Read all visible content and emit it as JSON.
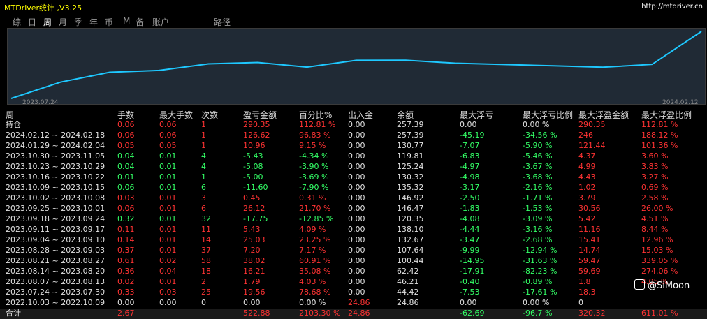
{
  "app": {
    "title": "MTDriver统计 ,V3.25",
    "url": "http://mtdriver.cn"
  },
  "tabs": [
    "综",
    "日",
    "周",
    "月",
    "季",
    "年",
    "币",
    "M",
    "备",
    "账户",
    "路径"
  ],
  "active_tab": 2,
  "chart_data": {
    "type": "line",
    "x_start": "2023.07.24",
    "x_end": "2024.02.12",
    "series": [
      {
        "color": "#1ec8ff",
        "values": [
          0,
          62.42,
          100.44,
          107.64,
          132.67,
          138.1,
          120.35,
          146.47,
          146.92,
          135.32,
          130.32,
          125.24,
          119.81,
          130.77,
          257.39
        ]
      }
    ]
  },
  "table": {
    "headers": [
      "周",
      "手数",
      "最大手数",
      "次数",
      "盈亏金额",
      "百分比%",
      "出入金",
      "余额",
      "最大浮亏",
      "最大浮亏比例",
      "最大浮盈金额",
      "最大浮盈比例"
    ],
    "rows": [
      {
        "c": [
          "持仓",
          "0.06",
          "0.06",
          "1",
          "290.35",
          "112.81 %",
          "0.00",
          "257.39",
          "0.00",
          "0.00 %",
          "290.35",
          "112.81 %"
        ],
        "k": [
          "w",
          "r",
          "r",
          "r",
          "r",
          "r",
          "w",
          "w",
          "w",
          "w",
          "r",
          "r"
        ]
      },
      {
        "c": [
          "2024.02.12 ~ 2024.02.18",
          "0.06",
          "0.06",
          "1",
          "126.62",
          "96.83 %",
          "0.00",
          "257.39",
          "-45.19",
          "-34.56 %",
          "246",
          "188.12 %"
        ],
        "k": [
          "w",
          "r",
          "r",
          "r",
          "r",
          "r",
          "w",
          "w",
          "g",
          "g",
          "r",
          "r"
        ]
      },
      {
        "c": [
          "2024.01.29 ~ 2024.02.04",
          "0.05",
          "0.05",
          "1",
          "10.96",
          "9.15 %",
          "0.00",
          "130.77",
          "-7.07",
          "-5.90 %",
          "121.44",
          "101.36 %"
        ],
        "k": [
          "w",
          "r",
          "r",
          "r",
          "r",
          "r",
          "w",
          "w",
          "g",
          "g",
          "r",
          "r"
        ]
      },
      {
        "c": [
          "2023.10.30 ~ 2023.11.05",
          "0.04",
          "0.01",
          "4",
          "-5.43",
          "-4.34 %",
          "0.00",
          "119.81",
          "-6.83",
          "-5.46 %",
          "4.37",
          "3.60 %"
        ],
        "k": [
          "w",
          "g",
          "g",
          "g",
          "g",
          "g",
          "w",
          "w",
          "g",
          "g",
          "r",
          "r"
        ]
      },
      {
        "c": [
          "2023.10.23 ~ 2023.10.29",
          "0.04",
          "0.01",
          "4",
          "-5.08",
          "-3.90 %",
          "0.00",
          "125.24",
          "-4.97",
          "-3.67 %",
          "4.99",
          "3.83 %"
        ],
        "k": [
          "w",
          "g",
          "g",
          "g",
          "g",
          "g",
          "w",
          "w",
          "g",
          "g",
          "r",
          "r"
        ]
      },
      {
        "c": [
          "2023.10.16 ~ 2023.10.22",
          "0.01",
          "0.01",
          "1",
          "-5.00",
          "-3.69 %",
          "0.00",
          "130.32",
          "-4.98",
          "-3.68 %",
          "4.43",
          "3.27 %"
        ],
        "k": [
          "w",
          "g",
          "g",
          "g",
          "g",
          "g",
          "w",
          "w",
          "g",
          "g",
          "r",
          "r"
        ]
      },
      {
        "c": [
          "2023.10.09 ~ 2023.10.15",
          "0.06",
          "0.01",
          "6",
          "-11.60",
          "-7.90 %",
          "0.00",
          "135.32",
          "-3.17",
          "-2.16 %",
          "1.02",
          "0.69 %"
        ],
        "k": [
          "w",
          "g",
          "g",
          "g",
          "g",
          "g",
          "w",
          "w",
          "g",
          "g",
          "r",
          "r"
        ]
      },
      {
        "c": [
          "2023.10.02 ~ 2023.10.08",
          "0.03",
          "0.01",
          "3",
          "0.45",
          "0.31 %",
          "0.00",
          "146.92",
          "-2.50",
          "-1.71 %",
          "3.79",
          "2.58 %"
        ],
        "k": [
          "w",
          "r",
          "r",
          "r",
          "r",
          "r",
          "w",
          "w",
          "g",
          "g",
          "r",
          "r"
        ]
      },
      {
        "c": [
          "2023.09.25 ~ 2023.10.01",
          "0.06",
          "0.01",
          "6",
          "26.12",
          "21.70 %",
          "0.00",
          "146.47",
          "-1.83",
          "-1.53 %",
          "30.56",
          "26.00 %"
        ],
        "k": [
          "w",
          "r",
          "r",
          "r",
          "r",
          "r",
          "w",
          "w",
          "g",
          "g",
          "r",
          "r"
        ]
      },
      {
        "c": [
          "2023.09.18 ~ 2023.09.24",
          "0.32",
          "0.01",
          "32",
          "-17.75",
          "-12.85 %",
          "0.00",
          "120.35",
          "-4.08",
          "-3.09 %",
          "5.42",
          "4.51 %"
        ],
        "k": [
          "w",
          "g",
          "g",
          "g",
          "g",
          "g",
          "w",
          "w",
          "g",
          "g",
          "r",
          "r"
        ]
      },
      {
        "c": [
          "2023.09.11 ~ 2023.09.17",
          "0.11",
          "0.01",
          "11",
          "5.43",
          "4.09 %",
          "0.00",
          "138.10",
          "-4.44",
          "-3.16 %",
          "11.16",
          "8.44 %"
        ],
        "k": [
          "w",
          "r",
          "r",
          "r",
          "r",
          "r",
          "w",
          "w",
          "g",
          "g",
          "r",
          "r"
        ]
      },
      {
        "c": [
          "2023.09.04 ~ 2023.09.10",
          "0.14",
          "0.01",
          "14",
          "25.03",
          "23.25 %",
          "0.00",
          "132.67",
          "-3.47",
          "-2.68 %",
          "15.41",
          "12.96 %"
        ],
        "k": [
          "w",
          "r",
          "r",
          "r",
          "r",
          "r",
          "w",
          "w",
          "g",
          "g",
          "r",
          "r"
        ]
      },
      {
        "c": [
          "2023.08.28 ~ 2023.09.03",
          "0.37",
          "0.01",
          "37",
          "7.20",
          "7.17 %",
          "0.00",
          "107.64",
          "-9.99",
          "-12.94 %",
          "14.74",
          "15.03 %"
        ],
        "k": [
          "w",
          "r",
          "r",
          "r",
          "r",
          "r",
          "w",
          "w",
          "g",
          "g",
          "r",
          "r"
        ]
      },
      {
        "c": [
          "2023.08.21 ~ 2023.08.27",
          "0.61",
          "0.02",
          "58",
          "38.02",
          "60.91 %",
          "0.00",
          "100.44",
          "-14.95",
          "-31.63 %",
          "59.47",
          "339.05 %"
        ],
        "k": [
          "w",
          "r",
          "r",
          "r",
          "r",
          "r",
          "w",
          "w",
          "g",
          "g",
          "r",
          "r"
        ]
      },
      {
        "c": [
          "2023.08.14 ~ 2023.08.20",
          "0.36",
          "0.04",
          "18",
          "16.21",
          "35.08 %",
          "0.00",
          "62.42",
          "-17.91",
          "-82.23 %",
          "59.69",
          "274.06 %"
        ],
        "k": [
          "w",
          "r",
          "r",
          "r",
          "r",
          "r",
          "w",
          "w",
          "g",
          "g",
          "r",
          "r"
        ]
      },
      {
        "c": [
          "2023.08.07 ~ 2023.08.13",
          "0.02",
          "0.01",
          "2",
          "1.79",
          "4.03 %",
          "0.00",
          "46.21",
          "-0.40",
          "-0.89 %",
          "1.8",
          "4.05 %"
        ],
        "k": [
          "w",
          "r",
          "r",
          "r",
          "r",
          "r",
          "w",
          "w",
          "g",
          "g",
          "r",
          "r"
        ]
      },
      {
        "c": [
          "2023.07.24 ~ 2023.07.30",
          "0.33",
          "0.03",
          "25",
          "19.56",
          "78.68 %",
          "0.00",
          "44.42",
          "-7.53",
          "-17.61 %",
          "18.3",
          "",
          ""
        ],
        "k": [
          "w",
          "r",
          "r",
          "r",
          "r",
          "r",
          "w",
          "w",
          "g",
          "g",
          "r",
          "r"
        ]
      },
      {
        "c": [
          "2022.10.03 ~ 2022.10.09",
          "0.00",
          "0.00",
          "0",
          "0.00",
          "0.00 %",
          "24.86",
          "24.86",
          "0.00",
          "0.00 %",
          "0",
          ""
        ],
        "k": [
          "w",
          "w",
          "w",
          "w",
          "w",
          "w",
          "r",
          "w",
          "w",
          "w",
          "w",
          "w"
        ]
      }
    ],
    "total": {
      "c": [
        "合计",
        "2.67",
        "",
        "",
        "522.88",
        "2103.30 %",
        "24.86",
        "",
        "-62.69",
        "-96.7 %",
        "320.32",
        "611.01 %"
      ],
      "k": [
        "w",
        "r",
        "w",
        "w",
        "r",
        "r",
        "r",
        "w",
        "g",
        "g",
        "r",
        "r"
      ]
    }
  },
  "watermark": "@SiMoon"
}
